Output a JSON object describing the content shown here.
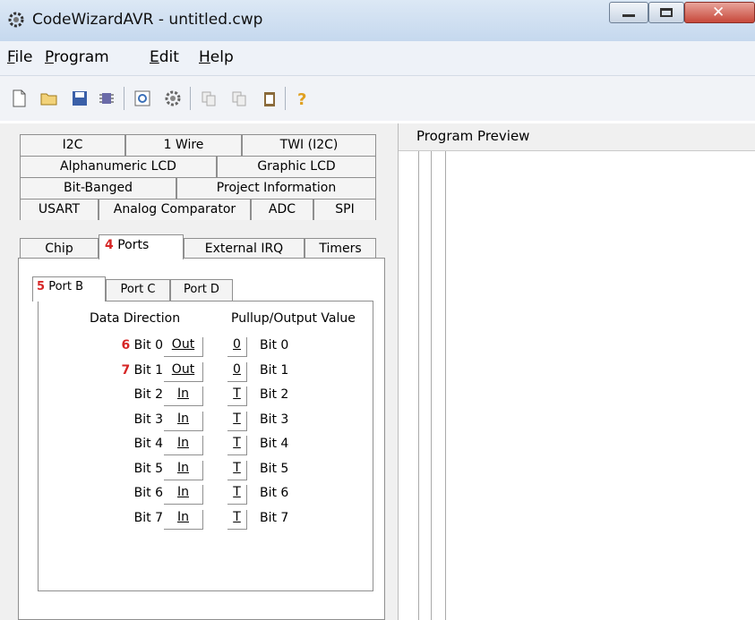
{
  "window": {
    "title": "CodeWizardAVR - untitled.cwp"
  },
  "menu": [
    {
      "label": "File",
      "hot": "F",
      "rest": "ile"
    },
    {
      "label": "Program",
      "hot": "P",
      "rest": "rogram"
    },
    {
      "label": "Edit",
      "hot": "E",
      "rest": "dit"
    },
    {
      "label": "Help",
      "hot": "H",
      "rest": "elp"
    }
  ],
  "toolbar": {
    "icons": [
      "new-file-icon",
      "open-folder-icon",
      "save-icon",
      "chip-icon",
      "preview-icon",
      "generate-gear-icon",
      "copy-icon",
      "paste-icon",
      "clipboard-icon",
      "help-question-icon"
    ]
  },
  "tabs": {
    "row1": [
      "I2C",
      "1 Wire",
      "TWI (I2C)"
    ],
    "row2": [
      "Alphanumeric LCD",
      "Graphic LCD"
    ],
    "row3": [
      "Bit-Banged",
      "Project Information"
    ],
    "row4": [
      "USART",
      "Analog Comparator",
      "ADC",
      "SPI"
    ],
    "row5": [
      "Chip",
      "Ports",
      "External IRQ",
      "Timers"
    ],
    "ports_step": "4"
  },
  "ports": {
    "subtabs": [
      "Port B",
      "Port C",
      "Port D"
    ],
    "portb_step": "5",
    "header_direction": "Data Direction",
    "header_value": "Pullup/Output Value",
    "bits": [
      {
        "step": "6",
        "label": "Bit 0",
        "dir": "Out",
        "val": "0",
        "val_label": "Bit 0"
      },
      {
        "step": "7",
        "label": "Bit 1",
        "dir": "Out",
        "val": "0",
        "val_label": "Bit 1"
      },
      {
        "step": "",
        "label": "Bit 2",
        "dir": "In",
        "val": "T",
        "val_label": "Bit 2"
      },
      {
        "step": "",
        "label": "Bit 3",
        "dir": "In",
        "val": "T",
        "val_label": "Bit 3"
      },
      {
        "step": "",
        "label": "Bit 4",
        "dir": "In",
        "val": "T",
        "val_label": "Bit 4"
      },
      {
        "step": "",
        "label": "Bit 5",
        "dir": "In",
        "val": "T",
        "val_label": "Bit 5"
      },
      {
        "step": "",
        "label": "Bit 6",
        "dir": "In",
        "val": "T",
        "val_label": "Bit 6"
      },
      {
        "step": "",
        "label": "Bit 7",
        "dir": "In",
        "val": "T",
        "val_label": "Bit 7"
      }
    ]
  },
  "preview": {
    "title": "Program Preview"
  },
  "colors": {
    "step_red": "#d62626",
    "titlebar": "#c5d8ee",
    "close_red": "#c7483a"
  }
}
